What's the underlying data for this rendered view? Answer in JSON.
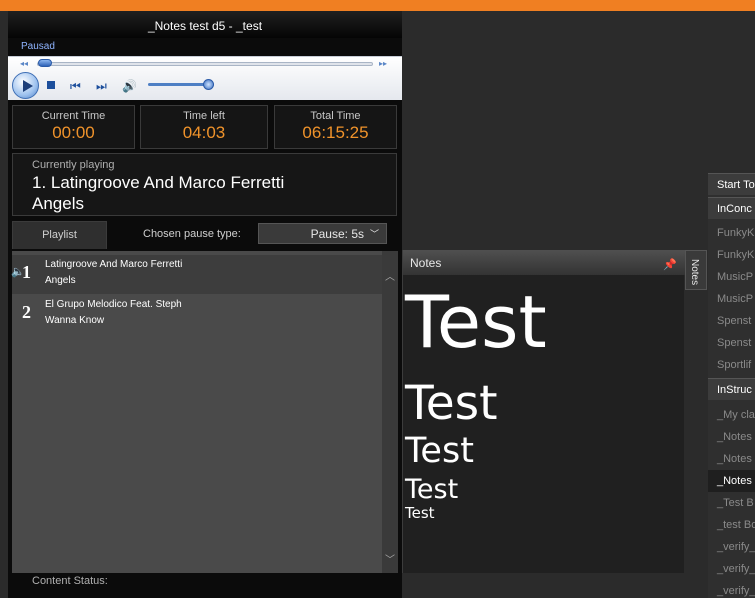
{
  "window": {
    "title": "_Notes test d5 - _test",
    "status": "Pausad"
  },
  "times": [
    {
      "label": "Current Time",
      "value": "00:00"
    },
    {
      "label": "Time left",
      "value": "04:03"
    },
    {
      "label": "Total Time",
      "value": "06:15:25"
    }
  ],
  "now_playing": {
    "label": "Currently playing",
    "line1": "1. Latingroove And Marco Ferretti",
    "line2": "Angels"
  },
  "controls": {
    "playlist_tab": "Playlist",
    "pause_type_label": "Chosen pause type:",
    "pause_value": "Pause: 5s"
  },
  "playlist": [
    {
      "num": "1",
      "artist": "Latingroove And Marco Ferretti",
      "title": "Angels"
    },
    {
      "num": "2",
      "artist": "El Grupo Melodico Feat. Steph",
      "title": "Wanna Know"
    }
  ],
  "footer": {
    "content_status": "Content Status:"
  },
  "notes": {
    "header": "Notes",
    "side_tab": "Notes",
    "lines": [
      "Test",
      "Test",
      "Test",
      "Test",
      "Test"
    ]
  },
  "right_panel": {
    "start_button": "Start To",
    "group1": "InConc",
    "group1_items": [
      "FunkyK",
      "FunkyK",
      "MusicP",
      "MusicP",
      "Spenst",
      "Spenst",
      "Sportlif"
    ],
    "group2": "InStruc",
    "group2_items": [
      "_My cla",
      "_Notes",
      "_Notes",
      "_Notes",
      "_Test B",
      "_test Bo",
      "_verify_",
      "_verify_",
      "_verify_"
    ]
  },
  "colors": {
    "accent": "#f07f22",
    "time_value": "#f0932b",
    "status_text": "#8fb4ff"
  }
}
